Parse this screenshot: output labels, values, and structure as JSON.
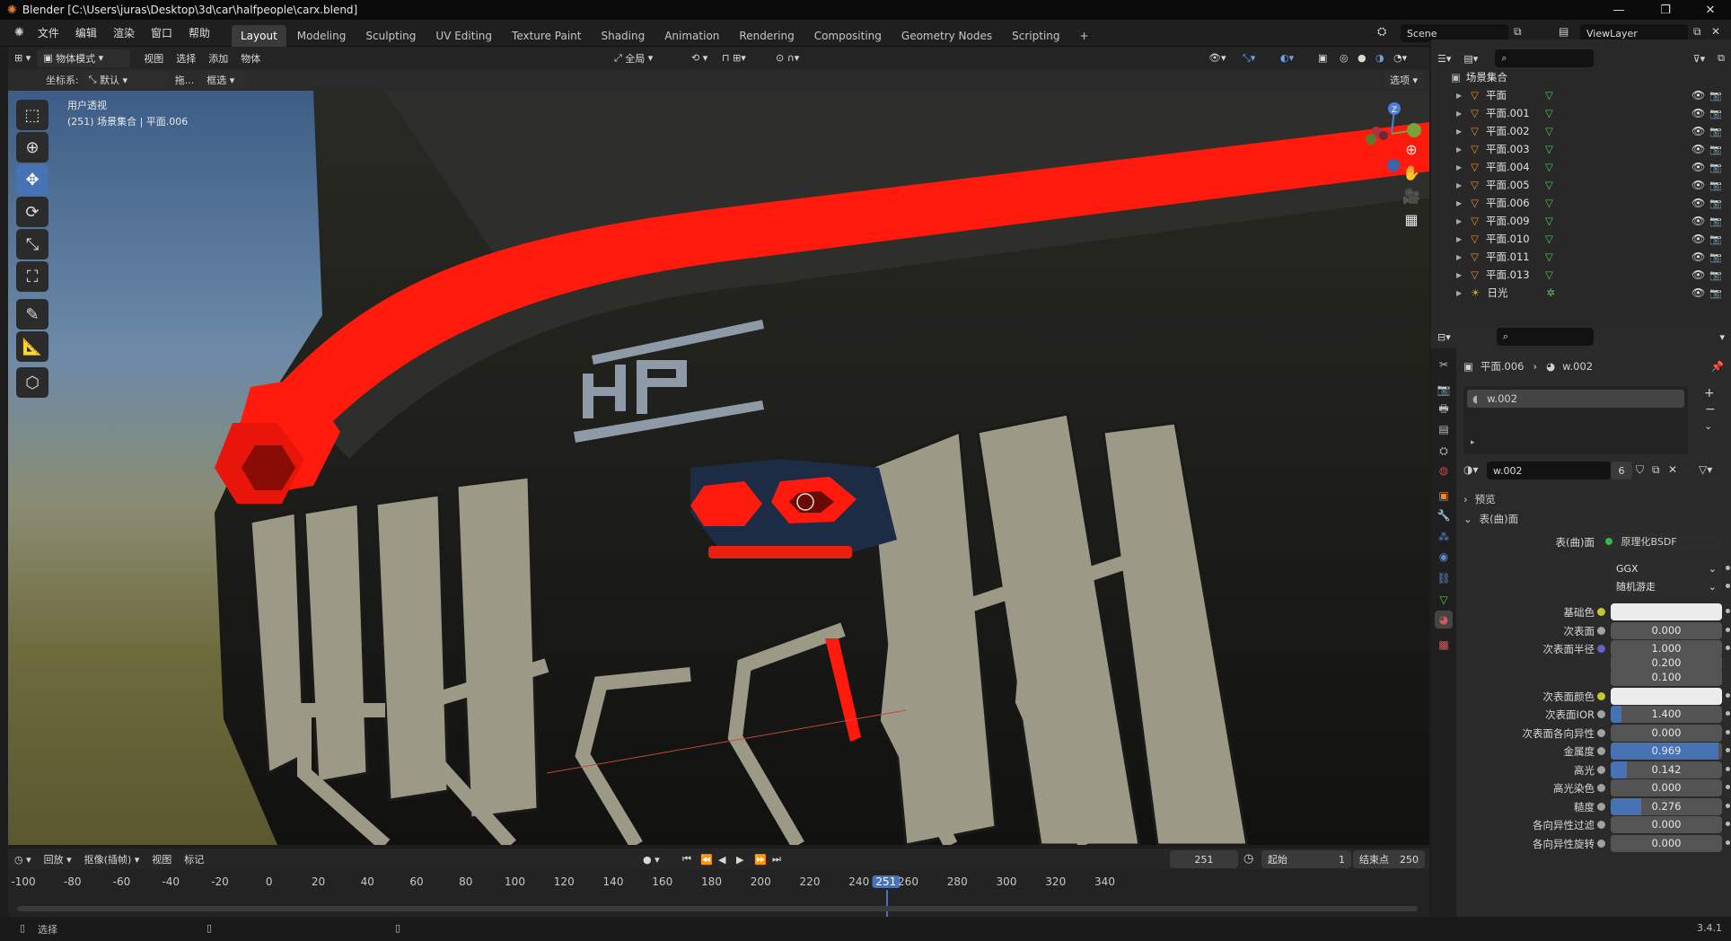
{
  "window": {
    "title": "Blender [C:\\Users\\juras\\Desktop\\3d\\car\\halfpeople\\carx.blend]"
  },
  "menu": [
    "文件",
    "编辑",
    "渲染",
    "窗口",
    "帮助"
  ],
  "workspace_tabs": [
    "Layout",
    "Modeling",
    "Sculpting",
    "UV Editing",
    "Texture Paint",
    "Shading",
    "Animation",
    "Rendering",
    "Compositing",
    "Geometry Nodes",
    "Scripting"
  ],
  "workspace_add": "+",
  "scene": "Scene",
  "view_layer": "ViewLayer",
  "viewport": {
    "mode": "物体模式",
    "menus": [
      "视图",
      "选择",
      "添加",
      "物体"
    ],
    "transform_orientation": "全局",
    "coord_label": "坐标系:",
    "coord_value": "默认",
    "drag_label": "拖...",
    "select_mode": "框选",
    "options": "选项",
    "overlay_title": "用户透视",
    "overlay_subtitle": "(251) 场景集合 | 平面.006",
    "gizmo_axis_z": "Z"
  },
  "timeline": {
    "playback": "回放",
    "keying": "抠像(插帧)",
    "view": "视图",
    "marker": "标记",
    "current_frame": "251",
    "start_label": "起始",
    "start_value": "1",
    "end_label": "结束点",
    "end_value": "250",
    "ruler": [
      "-100",
      "-80",
      "-60",
      "-40",
      "-20",
      "0",
      "20",
      "40",
      "60",
      "80",
      "100",
      "120",
      "140",
      "160",
      "180",
      "200",
      "220",
      "240",
      "251",
      "260",
      "280",
      "300",
      "320",
      "340"
    ]
  },
  "outliner": {
    "collection": "场景集合",
    "items": [
      "平面",
      "平面.001",
      "平面.002",
      "平面.003",
      "平面.004",
      "平面.005",
      "平面.006",
      "平面.009",
      "平面.010",
      "平面.011",
      "平面.013",
      "日光"
    ]
  },
  "properties": {
    "breadcrumb_object": "平面.006",
    "breadcrumb_material": "w.002",
    "slot_name": "w.002",
    "material_name": "w.002",
    "user_count": "6",
    "panel_preview": "预览",
    "panel_surface": "表(曲)面",
    "surface_label": "表(曲)面",
    "surface_value": "原理化BSDF",
    "distribution": "GGX",
    "subsurface_method": "随机游走",
    "rows": [
      {
        "label": "基础色",
        "type": "color",
        "value": ""
      },
      {
        "label": "次表面",
        "type": "number",
        "value": "0.000",
        "fill": 0
      },
      {
        "label": "次表面半径",
        "type": "number",
        "value": "1.000",
        "fill": 0
      },
      {
        "label": "",
        "type": "number",
        "value": "0.200",
        "fill": 0
      },
      {
        "label": "",
        "type": "number",
        "value": "0.100",
        "fill": 0
      },
      {
        "label": "次表面颜色",
        "type": "color",
        "value": ""
      },
      {
        "label": "次表面IOR",
        "type": "number",
        "value": "1.400",
        "fill": 0.1
      },
      {
        "label": "次表面各向异性",
        "type": "number",
        "value": "0.000",
        "fill": 0
      },
      {
        "label": "金属度",
        "type": "number",
        "value": "0.969",
        "fill": 0.969
      },
      {
        "label": "高光",
        "type": "number",
        "value": "0.142",
        "fill": 0.142
      },
      {
        "label": "高光染色",
        "type": "number",
        "value": "0.000",
        "fill": 0
      },
      {
        "label": "糙度",
        "type": "number",
        "value": "0.276",
        "fill": 0.276
      },
      {
        "label": "各向异性过滤",
        "type": "number",
        "value": "0.000",
        "fill": 0
      },
      {
        "label": "各向异性旋转",
        "type": "number",
        "value": "0.000",
        "fill": 0
      }
    ]
  },
  "status": {
    "left": "选择",
    "version": "3.4.1"
  },
  "colors": {
    "accent": "#4772b3",
    "bg": "#1d1d1d",
    "panel": "#2a2a2a",
    "red": "#ff1a0d"
  }
}
